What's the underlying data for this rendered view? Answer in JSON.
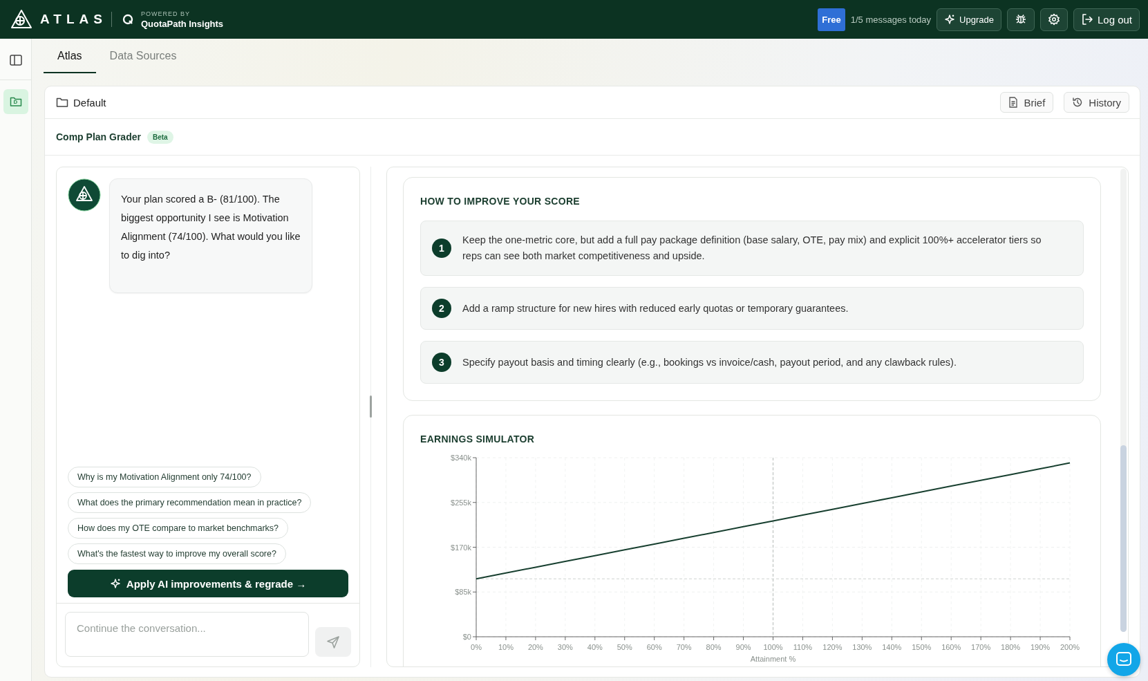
{
  "header": {
    "logo": "ATLAS",
    "powered_by": "POWERED BY",
    "partner": "QuotaPath Insights",
    "plan_badge": "Free",
    "usage": "1/5 messages today",
    "upgrade": "Upgrade",
    "logout": "Log out"
  },
  "sidebar": {
    "items": [
      {
        "kind": "panel-toggle",
        "selected": false
      },
      {
        "kind": "folder",
        "label": "D",
        "selected": true
      }
    ]
  },
  "tabs": [
    {
      "label": "Atlas",
      "selected": true
    },
    {
      "label": "Data Sources",
      "selected": false
    }
  ],
  "workspace": {
    "folder": "Default",
    "buttons": [
      {
        "kind": "brief",
        "label": "Brief"
      },
      {
        "kind": "history",
        "label": "History"
      }
    ]
  },
  "tool": {
    "title": "Comp Plan Grader",
    "badge": "Beta"
  },
  "chat": {
    "messages": [
      {
        "text": "Your plan scored a B- (81/100). The biggest opportunity I see is Motivation Alignment (74/100). What would you like to dig into?"
      }
    ],
    "suggestions": [
      "Why is my Motivation Alignment only 74/100?",
      "What does the primary recommendation mean in practice?",
      "How does my OTE compare to market benchmarks?",
      "What's the fastest way to improve my overall score?"
    ],
    "apply_button": "Apply AI improvements & regrade →",
    "input": {
      "placeholder": "Continue the conversation..."
    }
  },
  "improve": {
    "title": "HOW TO IMPROVE YOUR SCORE",
    "steps": [
      {
        "number": "1",
        "text": "Keep the one-metric core, but add a full pay package definition (base salary, OTE, pay mix) and explicit 100%+ accelerator tiers so reps can see both market competitiveness and upside."
      },
      {
        "number": "2",
        "text": "Add a ramp structure for new hires with reduced early quotas or temporary guarantees."
      },
      {
        "number": "3",
        "text": "Specify payout basis and timing clearly (e.g., bookings vs invoice/cash, payout period, and any clawback rules)."
      }
    ]
  },
  "simulator": {
    "title": "EARNINGS SIMULATOR",
    "chart_data": {
      "type": "line",
      "xlabel": "Attainment %",
      "x": [
        0,
        10,
        20,
        30,
        40,
        50,
        60,
        70,
        80,
        90,
        100,
        110,
        120,
        130,
        140,
        150,
        160,
        170,
        180,
        190,
        200
      ],
      "series": [
        {
          "color": "#173f2f",
          "values": [
            110000,
            121000,
            132000,
            143000,
            154000,
            165000,
            176000,
            187000,
            198000,
            209000,
            220000,
            231000,
            242000,
            253000,
            264000,
            275000,
            286000,
            297000,
            308000,
            319000,
            330000
          ]
        }
      ],
      "xlim": [
        0,
        200
      ],
      "ylim": [
        0,
        340000
      ],
      "xticks": [
        {
          "value": 0,
          "label": "0%"
        },
        {
          "value": 10,
          "label": "10%"
        },
        {
          "value": 20,
          "label": "20%"
        },
        {
          "value": 30,
          "label": "30%"
        },
        {
          "value": 40,
          "label": "40%"
        },
        {
          "value": 50,
          "label": "50%"
        },
        {
          "value": 60,
          "label": "60%"
        },
        {
          "value": 70,
          "label": "70%"
        },
        {
          "value": 80,
          "label": "80%"
        },
        {
          "value": 90,
          "label": "90%"
        },
        {
          "value": 100,
          "label": "100%"
        },
        {
          "value": 110,
          "label": "110%"
        },
        {
          "value": 120,
          "label": "120%"
        },
        {
          "value": 130,
          "label": "130%"
        },
        {
          "value": 140,
          "label": "140%"
        },
        {
          "value": 150,
          "label": "150%"
        },
        {
          "value": 160,
          "label": "160%"
        },
        {
          "value": 170,
          "label": "170%"
        },
        {
          "value": 180,
          "label": "180%"
        },
        {
          "value": 190,
          "label": "190%"
        },
        {
          "value": 200,
          "label": "200%"
        }
      ],
      "yticks": [
        {
          "value": 0,
          "label": "$0"
        },
        {
          "value": 85000,
          "label": "$85k"
        },
        {
          "value": 170000,
          "label": "$170k"
        },
        {
          "value": 255000,
          "label": "$255k"
        },
        {
          "value": 340000,
          "label": "$340k"
        }
      ],
      "grid": true,
      "ref_lines": [
        {
          "axis": "x",
          "value": 100
        },
        {
          "axis": "y",
          "value": 110000
        }
      ]
    }
  }
}
